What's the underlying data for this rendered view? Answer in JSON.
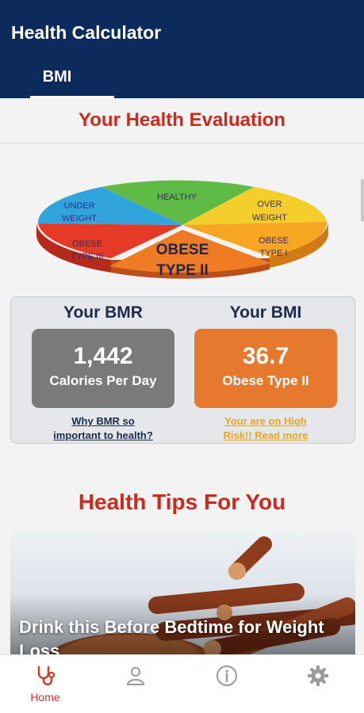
{
  "app": {
    "title": "Health Calculator"
  },
  "tabs": [
    {
      "label": "BMI",
      "active": true
    }
  ],
  "evaluation": {
    "title": "Your Health Evaluation",
    "chart": {
      "slices": [
        {
          "label_lines": [
            "HEALTHY"
          ],
          "color": "#5fba46"
        },
        {
          "label_lines": [
            "OVER",
            "WEIGHT"
          ],
          "color": "#f4cf2c"
        },
        {
          "label_lines": [
            "OBESE",
            "TYPE I"
          ],
          "color": "#f6a623"
        },
        {
          "label_lines": [
            "OBESE",
            "TYPE II"
          ],
          "color": "#ef7c25"
        },
        {
          "label_lines": [
            "OBESE",
            "TYPE III"
          ],
          "color": "#e53a26"
        },
        {
          "label_lines": [
            "UNDER",
            "WEIGHT"
          ],
          "color": "#32a4dd"
        }
      ],
      "highlighted": "OBESE TYPE II"
    }
  },
  "bmr": {
    "heading": "Your BMR",
    "value": "1,442",
    "unit": "Calories Per Day",
    "link_lines": [
      "Why BMR so",
      "important to health?"
    ]
  },
  "bmi": {
    "heading": "Your BMI",
    "value": "36.7",
    "category": "Obese Type II",
    "link_lines": [
      "Your are on High",
      "Risk!! Read more"
    ]
  },
  "tips": {
    "title": "Health Tips For You",
    "article_title": "Drink this Before Bedtime for Weight Loss"
  },
  "nav": [
    {
      "label": "Home",
      "icon": "stethoscope-icon",
      "active": true
    },
    {
      "label": "",
      "icon": "profile-icon",
      "active": false
    },
    {
      "label": "",
      "icon": "info-icon",
      "active": false
    },
    {
      "label": "",
      "icon": "gear-icon",
      "active": false
    }
  ],
  "colors": {
    "header": "#0c2a5c",
    "accent_red": "#cc2a1b",
    "bmr_box": "#7a7a7a",
    "bmi_box": "#e7792f",
    "link_warning": "#e6a521",
    "nav_active": "#cc3a2a",
    "nav_inactive": "#9a9a9a"
  }
}
